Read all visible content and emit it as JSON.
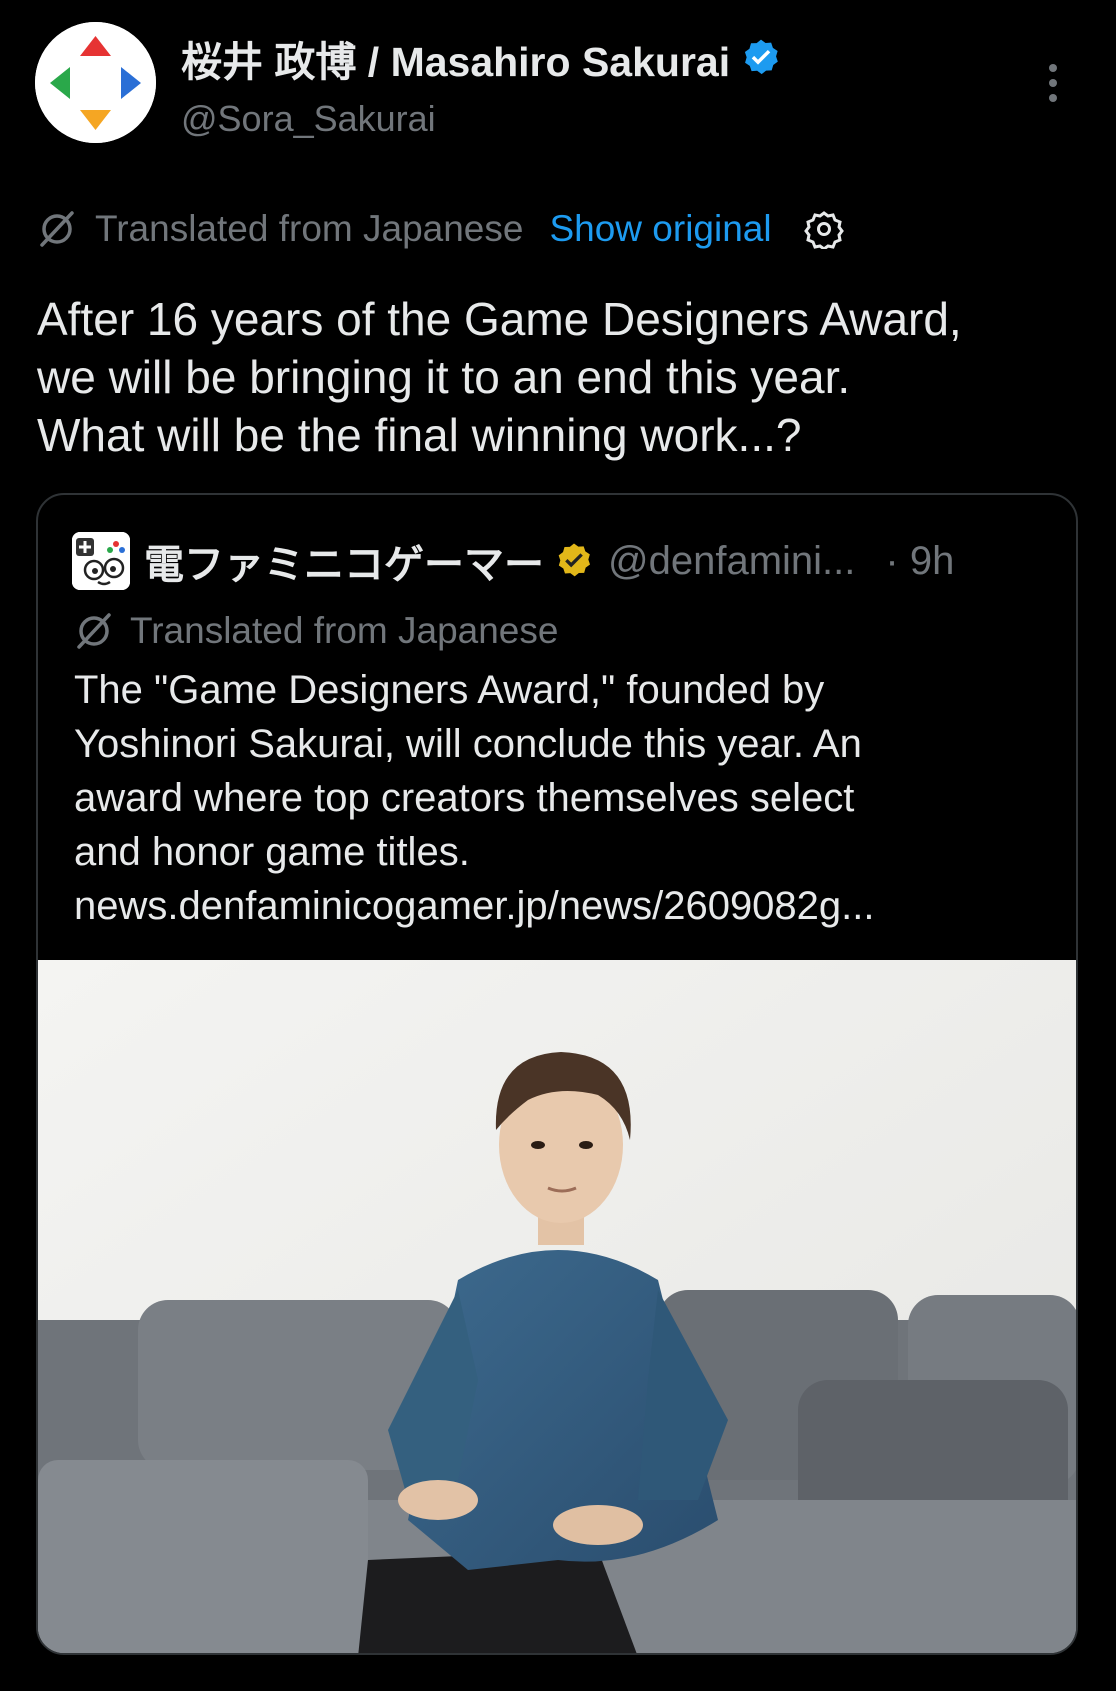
{
  "author": {
    "display_name": "桜井 政博 / Masahiro Sakurai",
    "handle": "@Sora_Sakurai",
    "verified": true,
    "avatar_icon": "game-dpad-logo-icon"
  },
  "translation": {
    "label": "Translated from Japanese",
    "show_original": "Show original"
  },
  "tweet": {
    "lines": [
      "After 16 years of the Game Designers Award,",
      "we will be bringing it to an end this year.",
      "What will be the final winning work...?"
    ]
  },
  "quote": {
    "display_name": "電ファミニコゲーマー",
    "handle": "@denfamini...",
    "time": "· 9h",
    "translation_label": "Translated from Japanese",
    "lines": [
      "The \"Game Designers Award,\" founded by",
      "Yoshinori Sakurai, will conclude this year. An",
      "award where top creators themselves select",
      "and honor game titles.",
      "news.denfaminicogamer.jp/news/2609082g..."
    ]
  },
  "colors": {
    "background": "#000000",
    "text": "#e7e9ea",
    "secondary": "#71767b",
    "link": "#1d9bf0",
    "verified_blue": "#1d9bf0",
    "verified_gold": "#e2b719"
  }
}
